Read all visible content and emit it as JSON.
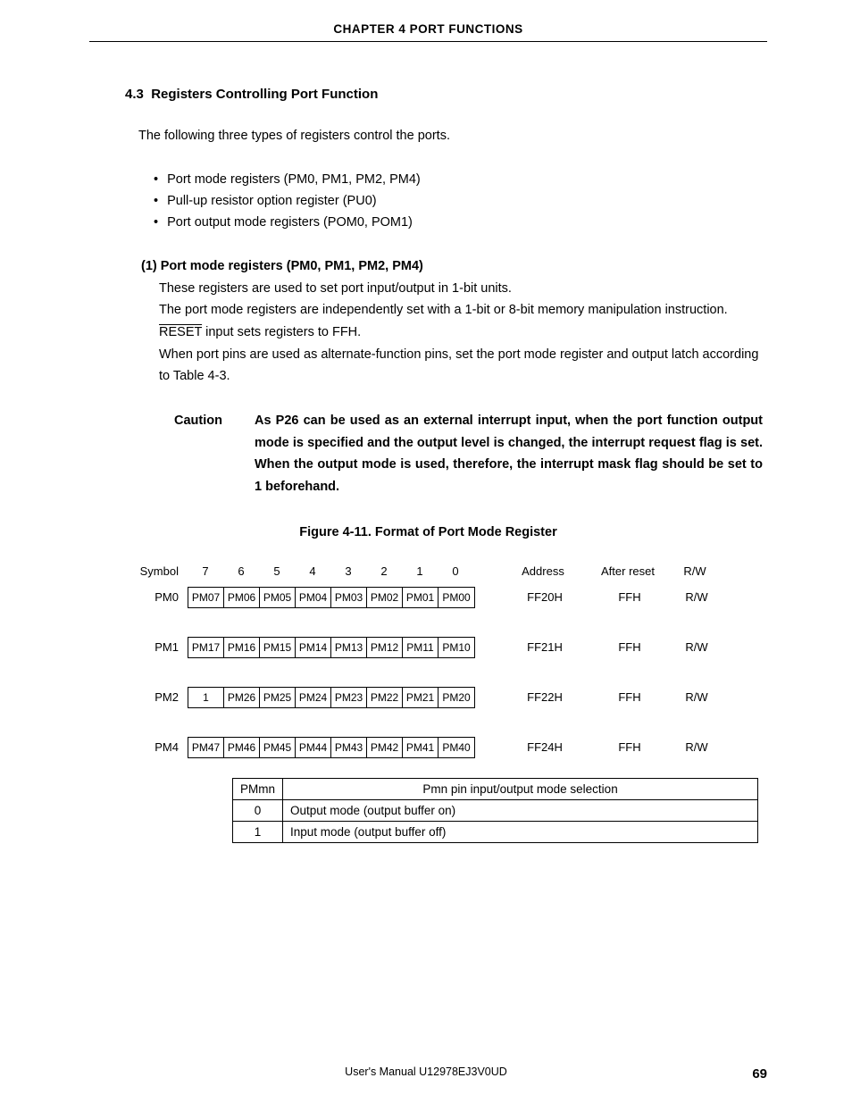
{
  "header": {
    "chapter": "CHAPTER 4   PORT FUNCTIONS"
  },
  "section": {
    "number": "4.3",
    "title": "Registers Controlling Port Function",
    "intro": "The following three types of registers control the ports.",
    "bullets": [
      "Port mode registers (PM0, PM1, PM2, PM4)",
      "Pull-up resistor option register (PU0)",
      "Port output mode registers (POM0, POM1)"
    ]
  },
  "sub": {
    "heading": "(1)  Port mode registers (PM0, PM1, PM2, PM4)",
    "p1": "These registers are used to set port input/output in 1-bit units.",
    "p2": "The port mode registers are independently set with a 1-bit or 8-bit memory manipulation instruction.",
    "p3a": "RESET",
    "p3b": " input sets registers to FFH.",
    "p4": "When port pins are used as alternate-function pins, set the port mode register and output latch according to Table 4-3."
  },
  "caution": {
    "label": "Caution",
    "text": "As P26 can be used as an external interrupt input, when the port function output mode is specified and the output level is changed, the interrupt request flag is set. When the output mode is used, therefore, the interrupt mask flag should be set to 1 beforehand."
  },
  "figure": {
    "title": "Figure 4-11.  Format of Port Mode Register",
    "col_symbol": "Symbol",
    "col_address": "Address",
    "col_reset": "After reset",
    "col_rw": "R/W",
    "bit_nums": [
      "7",
      "6",
      "5",
      "4",
      "3",
      "2",
      "1",
      "0"
    ],
    "rows": [
      {
        "sym": "PM0",
        "bits": [
          "PM07",
          "PM06",
          "PM05",
          "PM04",
          "PM03",
          "PM02",
          "PM01",
          "PM00"
        ],
        "addr": "FF20H",
        "reset": "FFH",
        "rw": "R/W"
      },
      {
        "sym": "PM1",
        "bits": [
          "PM17",
          "PM16",
          "PM15",
          "PM14",
          "PM13",
          "PM12",
          "PM11",
          "PM10"
        ],
        "addr": "FF21H",
        "reset": "FFH",
        "rw": "R/W"
      },
      {
        "sym": "PM2",
        "bits": [
          "1",
          "PM26",
          "PM25",
          "PM24",
          "PM23",
          "PM22",
          "PM21",
          "PM20"
        ],
        "addr": "FF22H",
        "reset": "FFH",
        "rw": "R/W"
      },
      {
        "sym": "PM4",
        "bits": [
          "PM47",
          "PM46",
          "PM45",
          "PM44",
          "PM43",
          "PM42",
          "PM41",
          "PM40"
        ],
        "addr": "FF24H",
        "reset": "FFH",
        "rw": "R/W"
      }
    ],
    "sel": {
      "key_header": "PMmn",
      "desc_header": "Pmn pin input/output mode selection",
      "r0k": "0",
      "r0d": "Output mode (output buffer on)",
      "r1k": "1",
      "r1d": "Input mode (output buffer off)"
    }
  },
  "footer": {
    "manual": "User's Manual  U12978EJ3V0UD",
    "page": "69"
  }
}
